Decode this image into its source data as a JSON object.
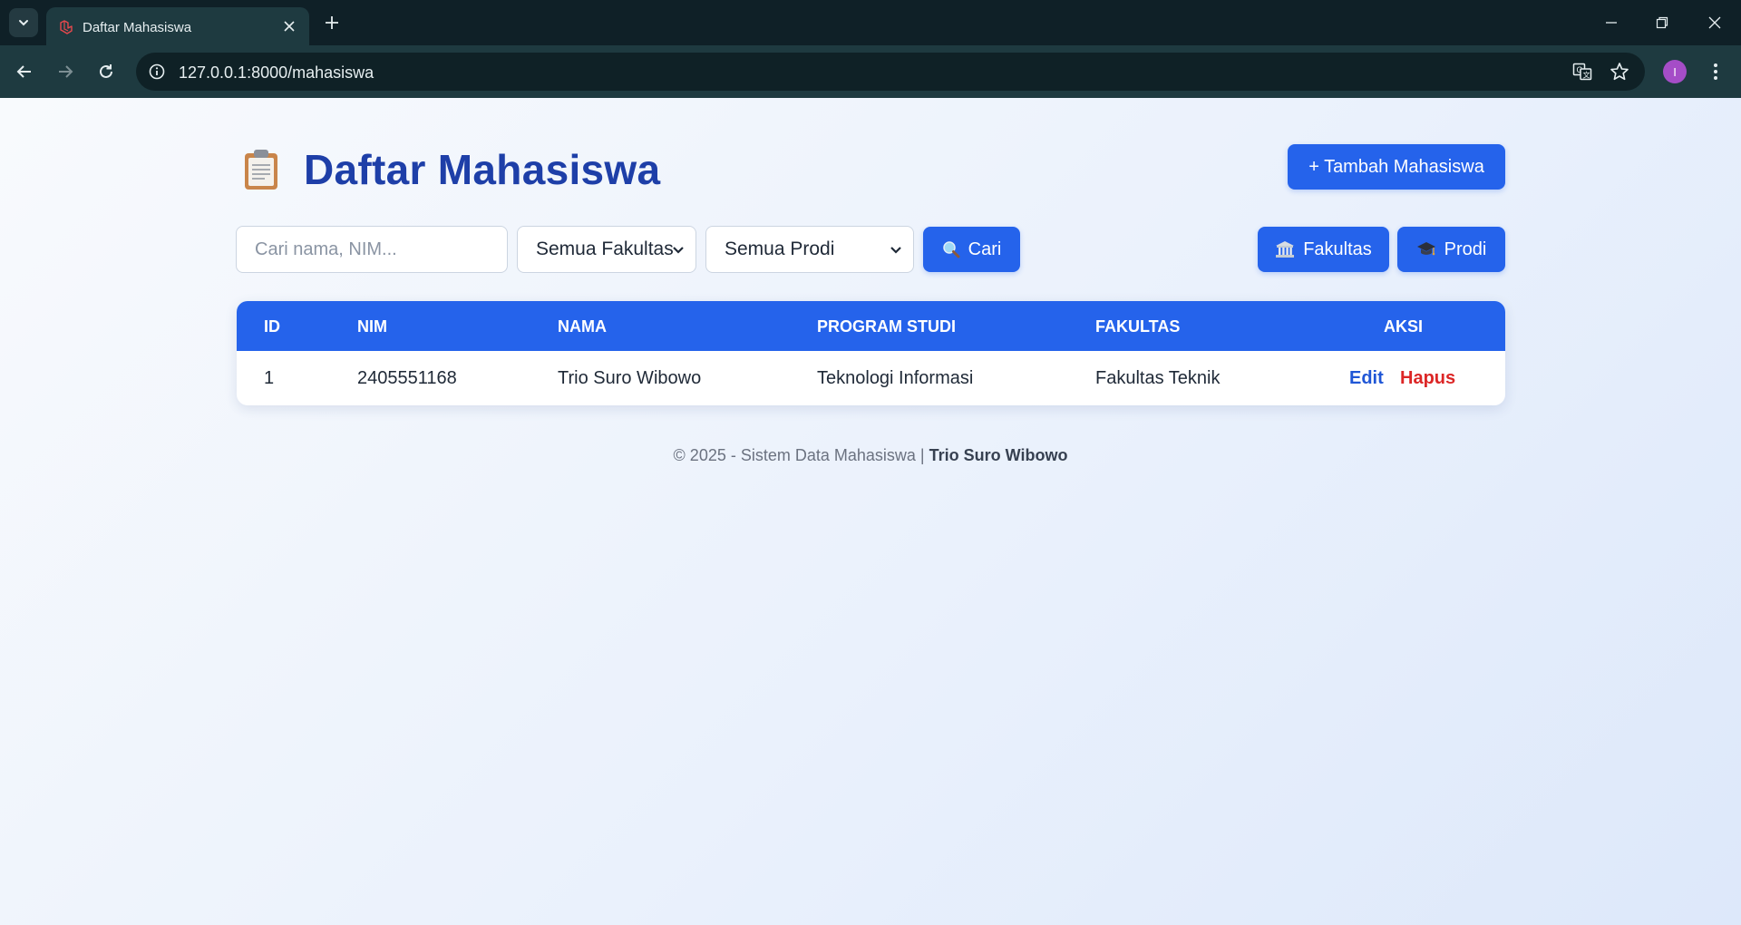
{
  "browser": {
    "tab_title": "Daftar Mahasiswa",
    "url": "127.0.0.1:8000/mahasiswa",
    "profile_initial": "I"
  },
  "page": {
    "title": "Daftar Mahasiswa",
    "add_button": "+ Tambah Mahasiswa",
    "search_placeholder": "Cari nama, NIM...",
    "fakultas_filter": "Semua Fakultas",
    "prodi_filter": "Semua Prodi",
    "search_button": "Cari",
    "fakultas_button": "Fakultas",
    "prodi_button": "Prodi"
  },
  "table": {
    "headers": [
      "ID",
      "NIM",
      "NAMA",
      "PROGRAM STUDI",
      "FAKULTAS",
      "AKSI"
    ],
    "rows": [
      {
        "id": "1",
        "nim": "2405551168",
        "nama": "Trio Suro Wibowo",
        "prodi": "Teknologi Informasi",
        "fakultas": "Fakultas Teknik",
        "edit": "Edit",
        "hapus": "Hapus"
      }
    ]
  },
  "footer": {
    "text": "© 2025 - Sistem Data Mahasiswa |",
    "author": "Trio Suro Wibowo"
  },
  "colors": {
    "primary": "#2563eb",
    "title": "#1e3fa8",
    "danger": "#dc2626"
  }
}
